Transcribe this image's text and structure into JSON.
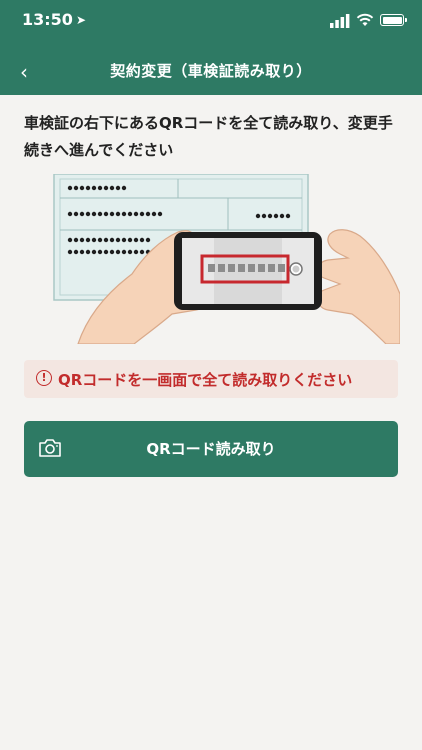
{
  "status_bar": {
    "time": "13:50"
  },
  "header": {
    "back_glyph": "‹",
    "title": "契約変更（車検証読み取り）"
  },
  "main": {
    "instruction": "車検証の右下にあるQRコードを全て読み取り、変更手続きへ進んでください",
    "warning": {
      "icon": "!",
      "text": "QRコードを一画面で全て読み取りください"
    },
    "scan_button": {
      "label": "QRコード読み取り"
    }
  },
  "colors": {
    "header_bg": "#2e7a64",
    "button_bg": "#2e7a64",
    "warning_bg": "#f3e6e1",
    "warning_text": "#c22c2c",
    "background": "#f4f3f1"
  },
  "icons": {
    "back": "chevron-left-icon",
    "warning": "exclamation-circle-icon",
    "camera": "camera-icon",
    "location": "location-arrow-icon",
    "signal": "cellular-signal-icon",
    "wifi": "wifi-icon",
    "battery": "battery-icon"
  }
}
